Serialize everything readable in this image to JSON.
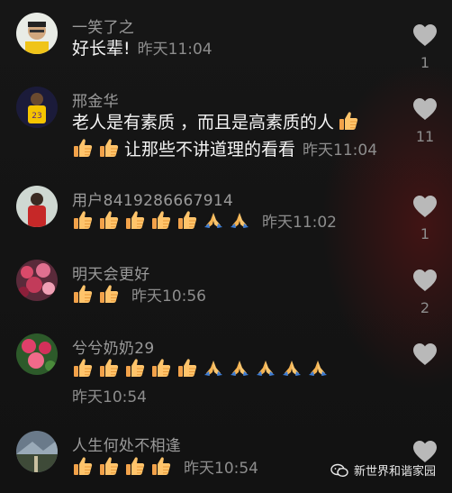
{
  "comments": [
    {
      "name": "一笑了之",
      "text": "好长辈!",
      "time": "昨天11:04",
      "likes": "1"
    },
    {
      "name": "邢金华",
      "text1": "老人是有素质 ，而且是高素质的人",
      "text2": "让那些不讲道理的看看",
      "time": "昨天11:04",
      "likes": "11"
    },
    {
      "name": "用户8419286667914",
      "time": "昨天11:02",
      "likes": "1"
    },
    {
      "name": "明天会更好",
      "time": "昨天10:56",
      "likes": "2"
    },
    {
      "name": "兮兮奶奶29",
      "time": "昨天10:54",
      "likes": ""
    },
    {
      "name": "人生何处不相逢",
      "time": "昨天10:54",
      "likes": ""
    }
  ],
  "watermark": "新世界和谐家园",
  "icons": {
    "like": "heart-icon",
    "thumbs": "thumbs-up-emoji",
    "pray": "folded-hands-emoji"
  },
  "colors": {
    "background": "#141414",
    "name": "#9a9a9a",
    "time": "#8d8d8d",
    "heart": "#b9b9b9"
  }
}
